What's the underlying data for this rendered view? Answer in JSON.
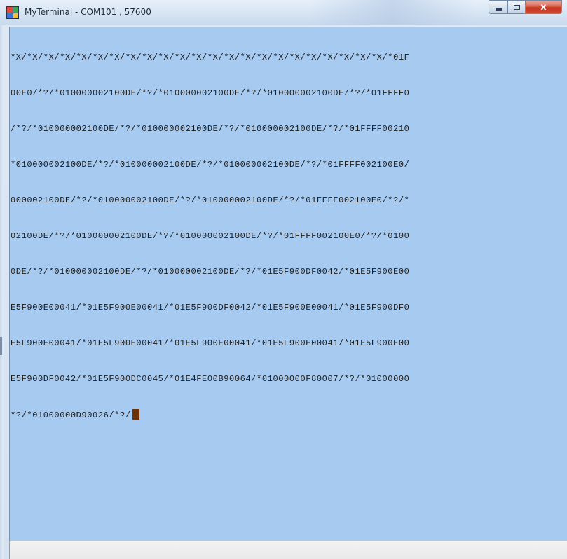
{
  "window": {
    "title": "MyTerminal - COM101 , 57600",
    "close_glyph": "x",
    "accent_color": "#a6caf0",
    "cursor_color": "#6b3208"
  },
  "terminal": {
    "lines": [
      "*X/*X/*X/*X/*X/*X/*X/*X/*X/*X/*X/*X/*X/*X/*X/*X/*X/*X/*X/*X/*X/*X/*X/*01F",
      "00E0/*?/*010000002100DE/*?/*010000002100DE/*?/*010000002100DE/*?/*01FFFF0",
      "/*?/*010000002100DE/*?/*010000002100DE/*?/*010000002100DE/*?/*01FFFF00210",
      "*010000002100DE/*?/*010000002100DE/*?/*010000002100DE/*?/*01FFFF002100E0/",
      "000002100DE/*?/*010000002100DE/*?/*010000002100DE/*?/*01FFFF002100E0/*?/*",
      "02100DE/*?/*010000002100DE/*?/*010000002100DE/*?/*01FFFF002100E0/*?/*0100",
      "0DE/*?/*010000002100DE/*?/*010000002100DE/*?/*01E5F900DF0042/*01E5F900E00",
      "E5F900E00041/*01E5F900E00041/*01E5F900DF0042/*01E5F900E00041/*01E5F900DF0",
      "E5F900E00041/*01E5F900E00041/*01E5F900E00041/*01E5F900E00041/*01E5F900E00",
      "E5F900DF0042/*01E5F900DC0045/*01E4FE00B90064/*01000000F80007/*?/*01000000",
      "*?/*01000000D90026/*?/"
    ]
  },
  "status_bar": {
    "text": ""
  }
}
